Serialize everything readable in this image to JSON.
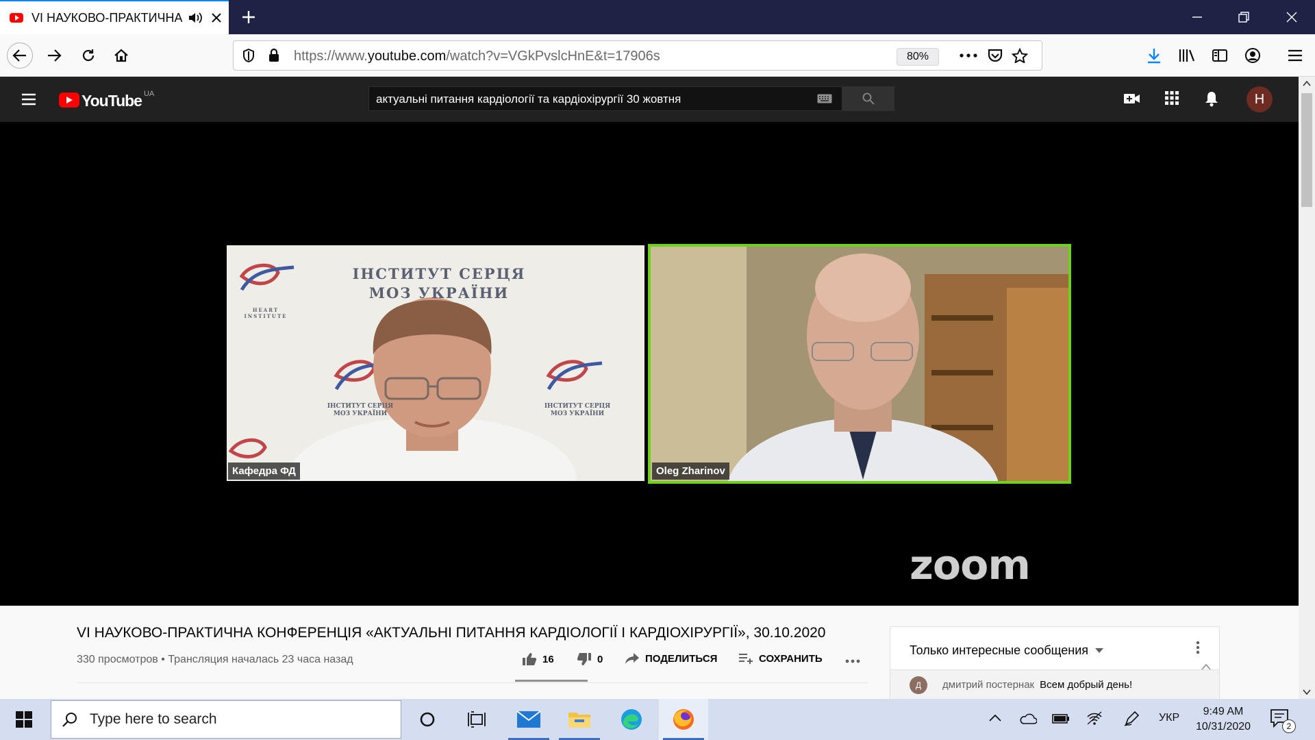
{
  "browser": {
    "tab_title": "VI НАУКОВО-ПРАКТИЧНА",
    "url_prefix": "https://www.",
    "url_host": "youtube.com",
    "url_path": "/watch?v=VGkPvslcHnE&t=17906s",
    "zoom": "80%"
  },
  "youtube": {
    "logo_word": "YouTube",
    "country": "UA",
    "search_query": "актуальні питання кардіології та кардіохірургії 30 жовтня",
    "avatar_letter": "Н",
    "brand_color": "#ff0000"
  },
  "video": {
    "participants": [
      {
        "name": "Кафедра ФД"
      },
      {
        "name": "Oleg Zharinov"
      }
    ],
    "backdrop_text_1": "ІНСТИТУТ СЕРЦЯ",
    "backdrop_text_2": "МОЗ УКРАЇНИ",
    "backdrop_small_1": "ІНСТИТУТ СЕРЦЯ",
    "backdrop_small_2": "МОЗ УКРАЇНИ",
    "backdrop_heart": "HEART INSTITUTE",
    "watermark": "zoom",
    "active_speaker_color": "#6ed11f"
  },
  "info": {
    "title": "VI НАУКОВО-ПРАКТИЧНА КОНФЕРЕНЦІЯ «АКТУАЛЬНІ ПИТАННЯ КАРДІОЛОГІЇ І КАРДІОХІРУРГІЇ», 30.10.2020",
    "meta": "330 просмотров • Трансляция началась 23 часа назад",
    "likes": "16",
    "dislikes": "0",
    "share": "ПОДЕЛИТЬСЯ",
    "save": "СОХРАНИТЬ"
  },
  "chat": {
    "filter": "Только интересные сообщения",
    "message": {
      "avatar": "Д",
      "author": "дмитрий постернак",
      "text": "Всем добрый день!"
    }
  },
  "taskbar": {
    "search_placeholder": "Type here to search",
    "language": "УКР",
    "time": "9:49 AM",
    "date": "10/31/2020",
    "notification_count": "2"
  }
}
